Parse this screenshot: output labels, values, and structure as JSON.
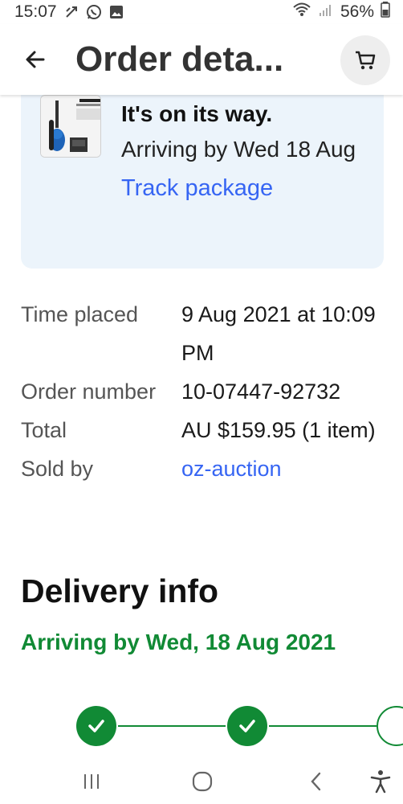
{
  "status_bar": {
    "time": "15:07",
    "battery": "56%",
    "icons": [
      "usb-debug-icon",
      "whatsapp-icon",
      "image-icon",
      "wifi-icon",
      "signal-icon",
      "battery-icon"
    ]
  },
  "header": {
    "title": "Order deta...",
    "back_icon": "arrow-left-icon",
    "cart_icon": "cart-icon"
  },
  "shipment": {
    "status_title": "It's on its way.",
    "arrival_text": "Arriving by Wed 18 Aug",
    "track_label": "Track package"
  },
  "details": [
    {
      "label": "Time placed",
      "value": "9 Aug 2021 at 10:09 PM"
    },
    {
      "label": "Order number",
      "value": "10-07447-92732"
    },
    {
      "label": "Total",
      "value": "AU $159.95 (1 item)"
    },
    {
      "label": "Sold by",
      "value": "oz-auction"
    }
  ],
  "delivery": {
    "section_title": "Delivery info",
    "arrival": "Arriving by Wed, 18 Aug 2021",
    "steps_completed": 2
  },
  "colors": {
    "link": "#3665f3",
    "success": "#118a35",
    "card_bg": "#ecf4fb"
  }
}
